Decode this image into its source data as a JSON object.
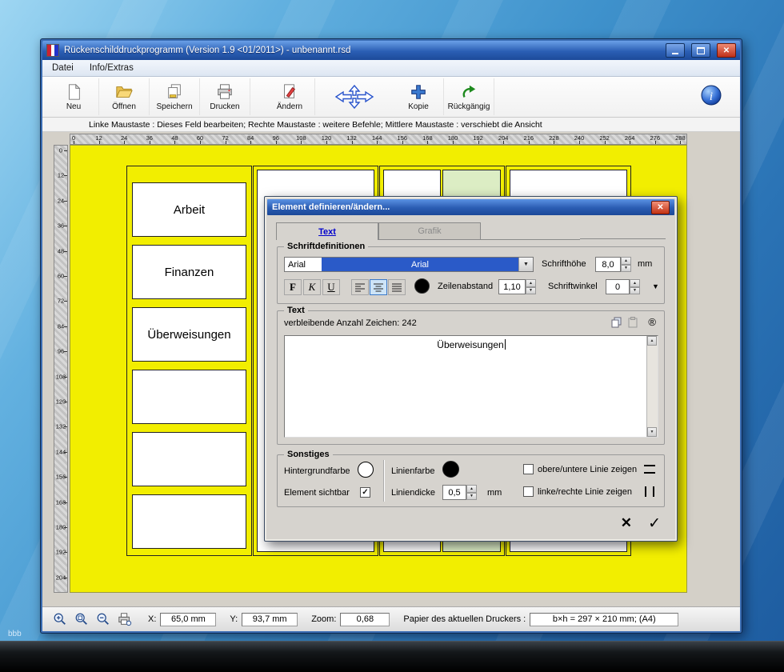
{
  "icons": {
    "close": "✕",
    "maximize": "□",
    "minimize": "–",
    "spin_up": "▲",
    "spin_down": "▼",
    "dropdown": "▼",
    "check": "✓",
    "scroll_up": "▲",
    "scroll_down": "▼",
    "registered": "®",
    "cancel": "✕",
    "ok": "✓"
  },
  "desktop": {
    "artifact_text": "bbb"
  },
  "window": {
    "title": "Rückenschilddruckprogramm (Version 1.9 <01/2011>) - unbenannt.rsd"
  },
  "menu": {
    "items": [
      {
        "label": "Datei"
      },
      {
        "label": "Info/Extras"
      }
    ]
  },
  "toolbar": {
    "items": [
      {
        "label": "Neu",
        "icon": "new-page-icon"
      },
      {
        "label": "Öffnen",
        "icon": "open-folder-icon"
      },
      {
        "label": "Speichern",
        "icon": "save-icon"
      },
      {
        "label": "Drucken",
        "icon": "print-icon"
      },
      {
        "label": "Ändern",
        "icon": "edit-icon"
      },
      {
        "label": "",
        "icon": "move-arrows-icon"
      },
      {
        "label": "Kopie",
        "icon": "copy-plus-icon"
      },
      {
        "label": "Rückgängig",
        "icon": "undo-icon"
      }
    ]
  },
  "hint": "Linke Maustaste : Dieses Feld bearbeiten;  Rechte Maustaste : weitere Befehle;  Mittlere Maustaste : verschiebt die Ansicht",
  "rulers": {
    "horizontal": [
      0,
      12,
      24,
      36,
      48,
      60,
      72,
      84,
      96,
      108,
      120,
      132,
      144,
      156,
      168,
      180,
      192,
      204,
      216,
      228,
      240,
      252,
      264,
      276,
      288
    ],
    "vertical": [
      0,
      12,
      24,
      36,
      48,
      60,
      72,
      84,
      96,
      108,
      120,
      132,
      144,
      156,
      168,
      180,
      192,
      204
    ]
  },
  "canvas": {
    "page_color": "#f2ee00",
    "highlight_color": "#dcedc4",
    "column1_cells": [
      "Arbeit",
      "Finanzen",
      "Überweisungen",
      "",
      "",
      ""
    ]
  },
  "dialog": {
    "title": "Element definieren/ändern...",
    "tabs": [
      {
        "label": "Text"
      },
      {
        "label": "Grafik"
      }
    ],
    "font_section": {
      "legend": "Schriftdefinitionen",
      "font_name": "Arial",
      "font_name_selected": "Arial",
      "schrifthoehe_label": "Schrifthöhe",
      "schrifthoehe_value": "8,0",
      "mm": "mm",
      "bold": "F",
      "italic": "K",
      "underline": "U",
      "zeilenabstand_label": "Zeilenabstand",
      "zeilenabstand_value": "1,10",
      "schriftwinkel_label": "Schriftwinkel",
      "schriftwinkel_value": "0"
    },
    "text_section": {
      "legend": "Text",
      "remaining_label": "verbleibende Anzahl Zeichen: 242",
      "content": "Überweisungen"
    },
    "misc_section": {
      "legend": "Sonstiges",
      "hintergrundfarbe_label": "Hintergrundfarbe",
      "element_sichtbar_label": "Element sichtbar",
      "linienfarbe_label": "Linienfarbe",
      "liniendicke_label": "Liniendicke",
      "liniendicke_value": "0,5",
      "mm": "mm",
      "top_bottom_label": "obere/untere Linie zeigen",
      "left_right_label": "linke/rechte Linie zeigen"
    }
  },
  "statusbar": {
    "x_label": "X:",
    "x_value": "65,0 mm",
    "y_label": "Y:",
    "y_value": "93,7 mm",
    "zoom_label": "Zoom:",
    "zoom_value": "0,68",
    "paper_label": "Papier des aktuellen Druckers :",
    "paper_value": "b×h = 297 × 210 mm; (A4)"
  }
}
